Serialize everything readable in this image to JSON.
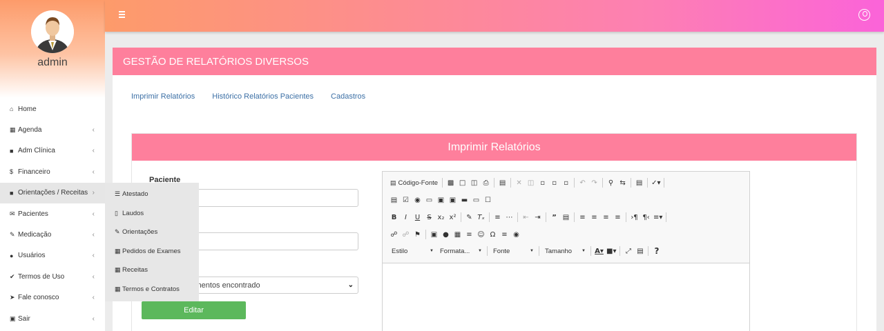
{
  "sidebar": {
    "username": "admin",
    "items": [
      {
        "icon": "home-icon",
        "glyph": "⌂",
        "label": "Home",
        "chevron": ""
      },
      {
        "icon": "calendar-icon",
        "glyph": "▦",
        "label": "Agenda",
        "chevron": "‹"
      },
      {
        "icon": "book-icon",
        "glyph": "■",
        "label": "Adm Clínica",
        "chevron": "‹"
      },
      {
        "icon": "dollar-icon",
        "glyph": "$",
        "label": "Financeiro",
        "chevron": "‹"
      },
      {
        "icon": "book-icon",
        "glyph": "■",
        "label": "Orientações / Receitas",
        "chevron": "›"
      },
      {
        "icon": "envelope-icon",
        "glyph": "✉",
        "label": "Pacientes",
        "chevron": "‹"
      },
      {
        "icon": "edit-icon",
        "glyph": "✎",
        "label": "Medicação",
        "chevron": "‹"
      },
      {
        "icon": "users-icon",
        "glyph": "●",
        "label": "Usuários",
        "chevron": "‹"
      },
      {
        "icon": "check-icon",
        "glyph": "✔",
        "label": "Termos de Uso",
        "chevron": "‹"
      },
      {
        "icon": "send-icon",
        "glyph": "➤",
        "label": "Fale conosco",
        "chevron": "‹"
      },
      {
        "icon": "lock-icon",
        "glyph": "▣",
        "label": "Sair",
        "chevron": "‹"
      }
    ]
  },
  "submenu": {
    "items": [
      {
        "icon": "list-icon",
        "glyph": "☰",
        "label": "Atestado"
      },
      {
        "icon": "bookmark-icon",
        "glyph": "▯",
        "label": "Laudos"
      },
      {
        "icon": "edit-icon",
        "glyph": "✎",
        "label": "Orientações"
      },
      {
        "icon": "calendar-icon",
        "glyph": "▦",
        "label": "Pedidos de Exames"
      },
      {
        "icon": "calendar-plus-icon",
        "glyph": "▦",
        "label": "Receitas"
      },
      {
        "icon": "calendar-icon",
        "glyph": "▦",
        "label": "Termos e Contratos"
      }
    ]
  },
  "panel": {
    "title": "GESTÃO DE RELATÓRIOS DIVERSOS",
    "tabs": [
      "Imprimir Relatórios",
      "Histórico Relatórios Pacientes",
      "Cadastros"
    ]
  },
  "form": {
    "header": "Imprimir Relatórios",
    "paciente_label": "Paciente",
    "select_value": "Nenhum documentos encontrado",
    "edit_button": "Editar"
  },
  "editor": {
    "source_label": "Código-Fonte",
    "combos": [
      "Estilo",
      "Formata...",
      "Fonte",
      "Tamanho"
    ],
    "help": "?"
  },
  "colors": {
    "header_pink": "#fe7f9c",
    "topbar_start": "#fd9b6a",
    "topbar_end": "#fb63d9",
    "button_green": "#5cb85c",
    "link_blue": "#3b6fa5"
  }
}
